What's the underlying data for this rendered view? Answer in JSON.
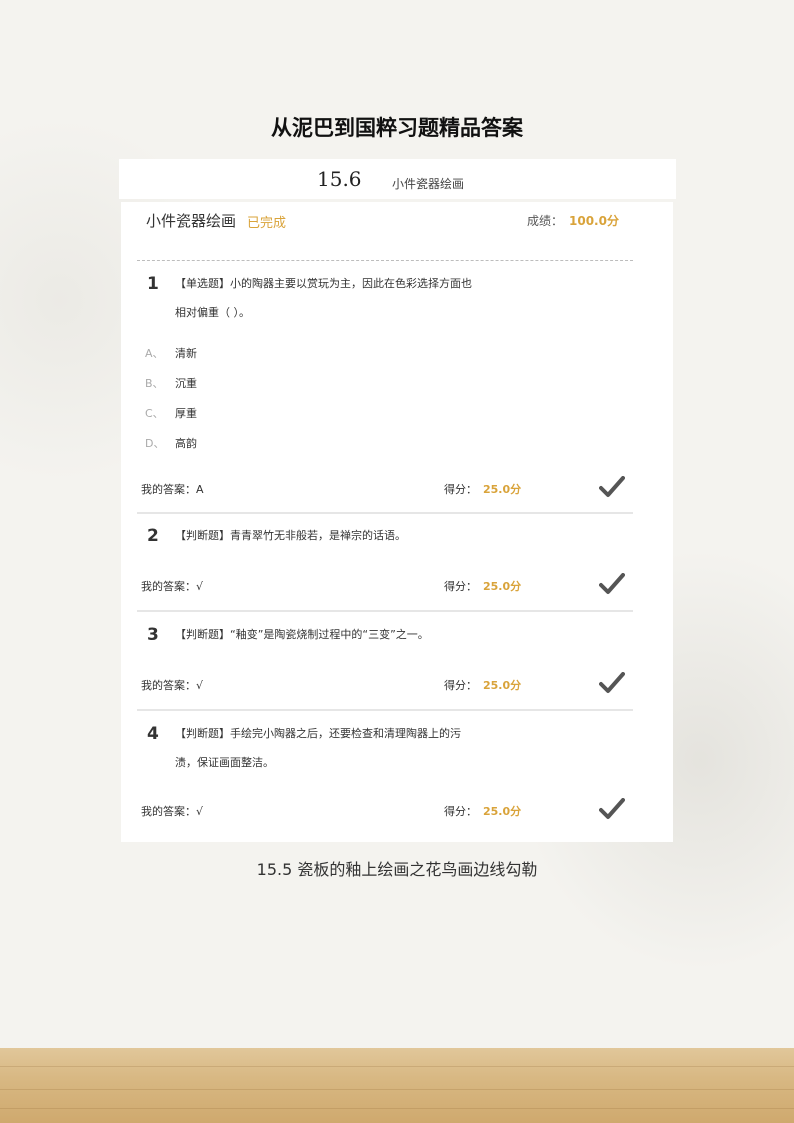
{
  "document": {
    "title": "从泥巴到国粹习题精品答案"
  },
  "section": {
    "number": "15.6",
    "title": "小件瓷器绘画"
  },
  "card": {
    "title": "小件瓷器绘画",
    "status": "已完成",
    "score_label": "成绩：",
    "score_value": "100.0分"
  },
  "labels": {
    "answer": "我的答案：",
    "got": "得分："
  },
  "questions": [
    {
      "num": "1",
      "type": "【单选题】",
      "text_line1": "小的陶器主要以赏玩为主，因此在色彩选择方面也",
      "text_line2": "相对偏重（ ）。",
      "options": [
        {
          "letter": "A、",
          "text": "清新"
        },
        {
          "letter": "B、",
          "text": "沉重"
        },
        {
          "letter": "C、",
          "text": "厚重"
        },
        {
          "letter": "D、",
          "text": "高韵"
        }
      ],
      "answer": "A",
      "score": "25.0分",
      "mark_icon": "checkmark-icon"
    },
    {
      "num": "2",
      "type": "【判断题】",
      "text_line1": "青青翠竹无非般若，是禅宗的话语。",
      "answer": "√",
      "score": "25.0分",
      "mark_icon": "checkmark-icon"
    },
    {
      "num": "3",
      "type": "【判断题】",
      "text_line1": "“釉变”是陶瓷烧制过程中的“三变”之一。",
      "answer": "√",
      "score": "25.0分",
      "mark_icon": "checkmark-icon"
    },
    {
      "num": "4",
      "type": "【判断题】",
      "text_line1": "手绘完小陶器之后，还要检查和清理陶器上的污",
      "text_line2": "渍，保证画面整洁。",
      "answer": "√",
      "score": "25.0分",
      "mark_icon": "checkmark-icon"
    }
  ],
  "next_caption": "15.5 瓷板的釉上绘画之花鸟画边线勾勒",
  "colors": {
    "accent": "#d9a33a",
    "check": "#555555",
    "card_bg": "#ffffff"
  }
}
